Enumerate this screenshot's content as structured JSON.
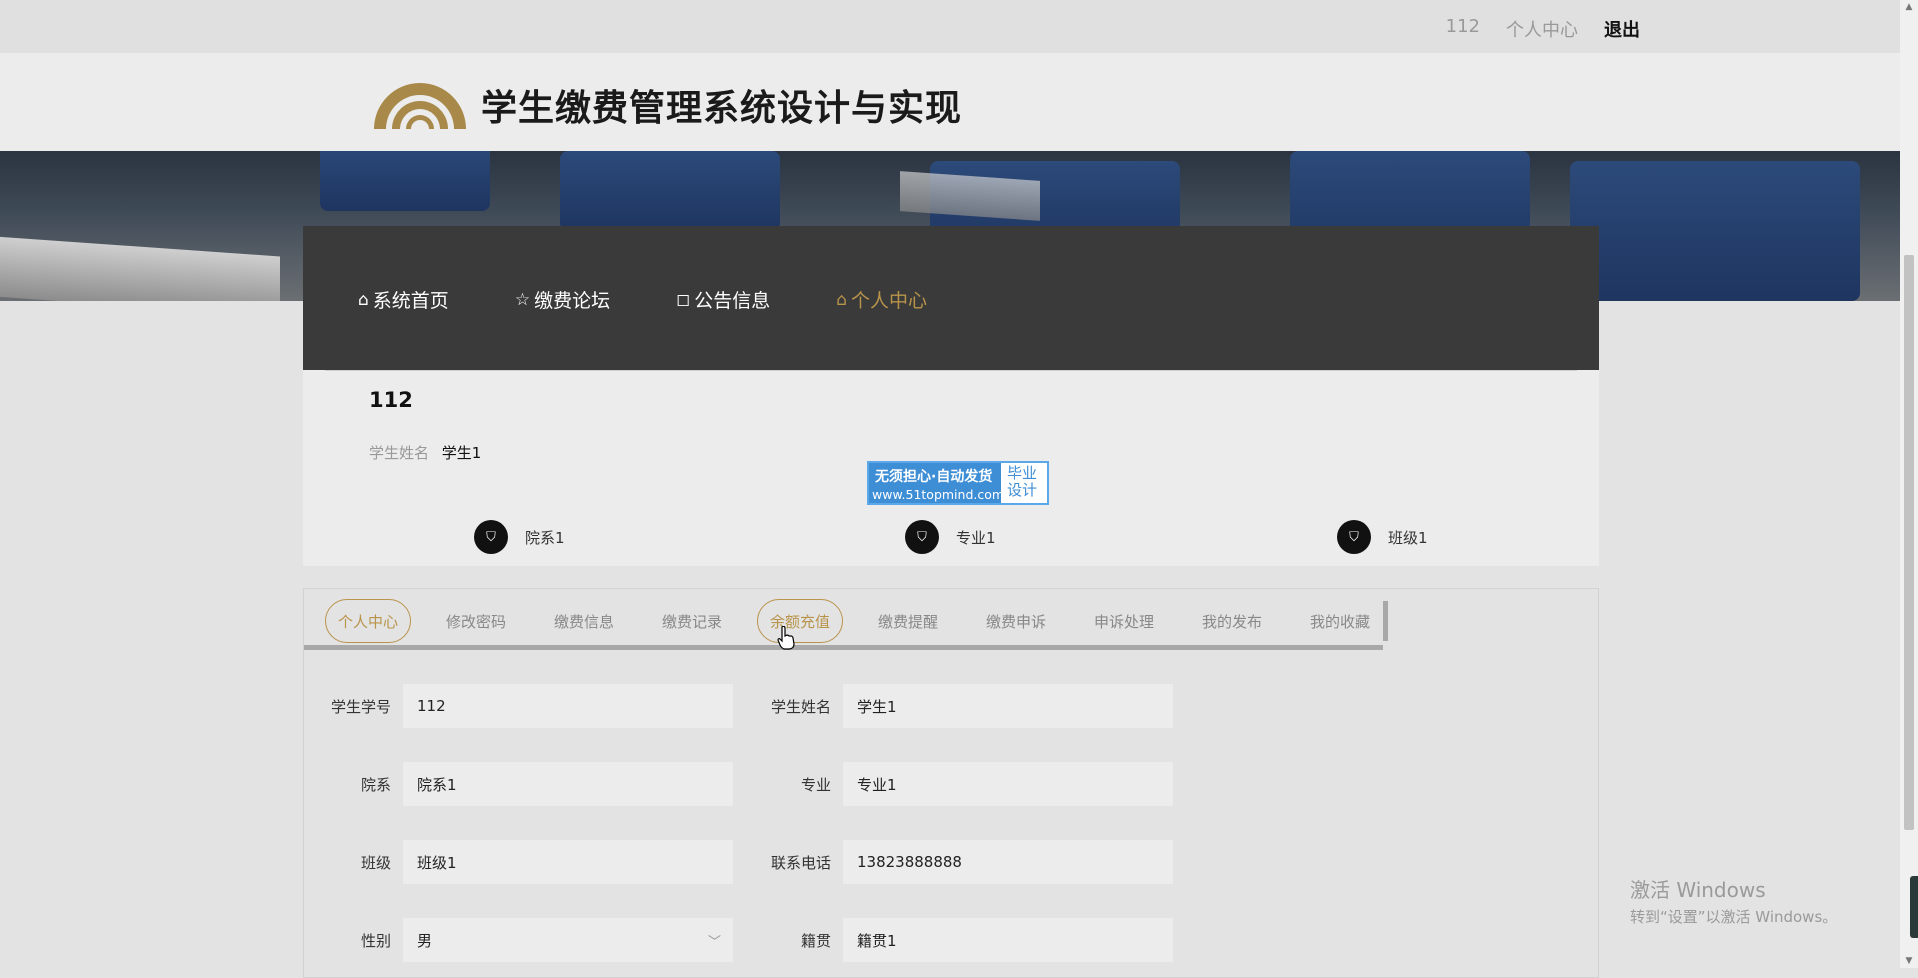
{
  "topbar": {
    "user": "112",
    "center": "个人中心",
    "logout": "退出"
  },
  "site": {
    "title": "学生缴费管理系统设计与实现",
    "accent": "#b8944b"
  },
  "nav": [
    {
      "icon": "home-icon",
      "glyph": "⌂",
      "label": "系统首页"
    },
    {
      "icon": "star-icon",
      "glyph": "☆",
      "label": "缴费论坛"
    },
    {
      "icon": "bag-icon",
      "glyph": "◻",
      "label": "公告信息"
    },
    {
      "icon": "home-icon",
      "glyph": "⌂",
      "label": "个人中心"
    }
  ],
  "profile": {
    "id": "112",
    "name_label": "学生姓名",
    "name": "学生1",
    "badges": [
      "院系1",
      "专业1",
      "班级1"
    ]
  },
  "ad": {
    "line1": "无须担心·自动发货",
    "line2": "www.51topmind.com",
    "right": "毕业设计"
  },
  "tabs": [
    "个人中心",
    "修改密码",
    "缴费信息",
    "缴费记录",
    "余额充值",
    "缴费提醒",
    "缴费申诉",
    "申诉处理",
    "我的发布",
    "我的收藏"
  ],
  "form": {
    "student_no_label": "学生学号",
    "student_no": "112",
    "student_name_label": "学生姓名",
    "student_name": "学生1",
    "dept_label": "院系",
    "dept": "院系1",
    "major_label": "专业",
    "major": "专业1",
    "class_label": "班级",
    "class": "班级1",
    "phone_label": "联系电话",
    "phone": "13823888888",
    "gender_label": "性别",
    "gender": "男",
    "native_label": "籍贯",
    "native": "籍贯1"
  },
  "watermark": {
    "line1": "激活 Windows",
    "line2": "转到“设置”以激活 Windows。"
  }
}
